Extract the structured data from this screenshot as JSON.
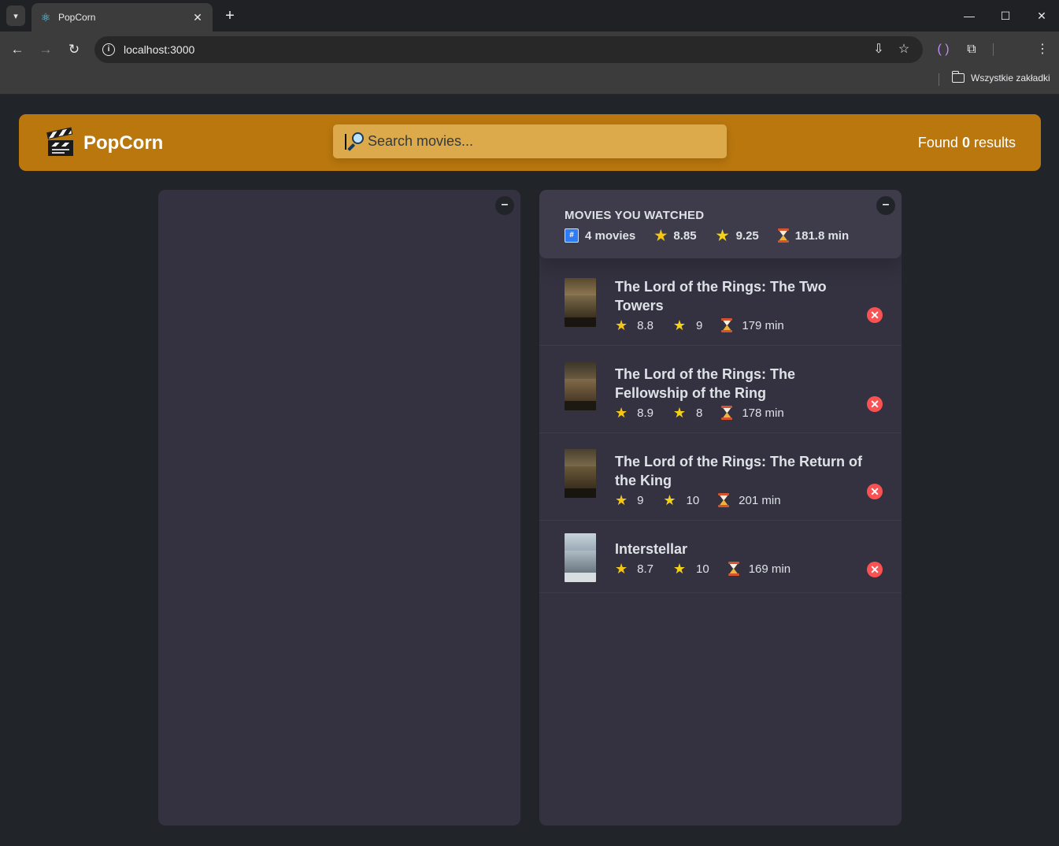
{
  "browser": {
    "tab_title": "PopCorn",
    "url": "localhost:3000",
    "bookmarks_folder": "Wszystkie zakładki"
  },
  "app": {
    "logo_text": "PopCorn",
    "search_placeholder": "Search movies...",
    "results_prefix": "Found ",
    "results_count": "0",
    "results_suffix": " results",
    "accent_color": "#b9770e"
  },
  "summary": {
    "title": "Movies you watched",
    "movies_count": "4 movies",
    "avg_imdb_rating": "8.85",
    "avg_user_rating": "9.25",
    "avg_runtime": "181.8 min"
  },
  "watched": [
    {
      "title": "The Lord of the Rings: The Two Towers",
      "imdb_rating": "8.8",
      "user_rating": "9",
      "runtime": "179 min"
    },
    {
      "title": "The Lord of the Rings: The Fellowship of the Ring",
      "imdb_rating": "8.9",
      "user_rating": "8",
      "runtime": "178 min"
    },
    {
      "title": "The Lord of the Rings: The Return of the King",
      "imdb_rating": "9",
      "user_rating": "10",
      "runtime": "201 min"
    },
    {
      "title": "Interstellar",
      "imdb_rating": "8.7",
      "user_rating": "10",
      "runtime": "169 min"
    }
  ],
  "icons": {
    "toggle": "minus-icon",
    "delete": "x-icon",
    "count": "hash-icon",
    "imdb": "star-icon",
    "user": "star2-icon",
    "runtime": "hourglass-icon"
  }
}
